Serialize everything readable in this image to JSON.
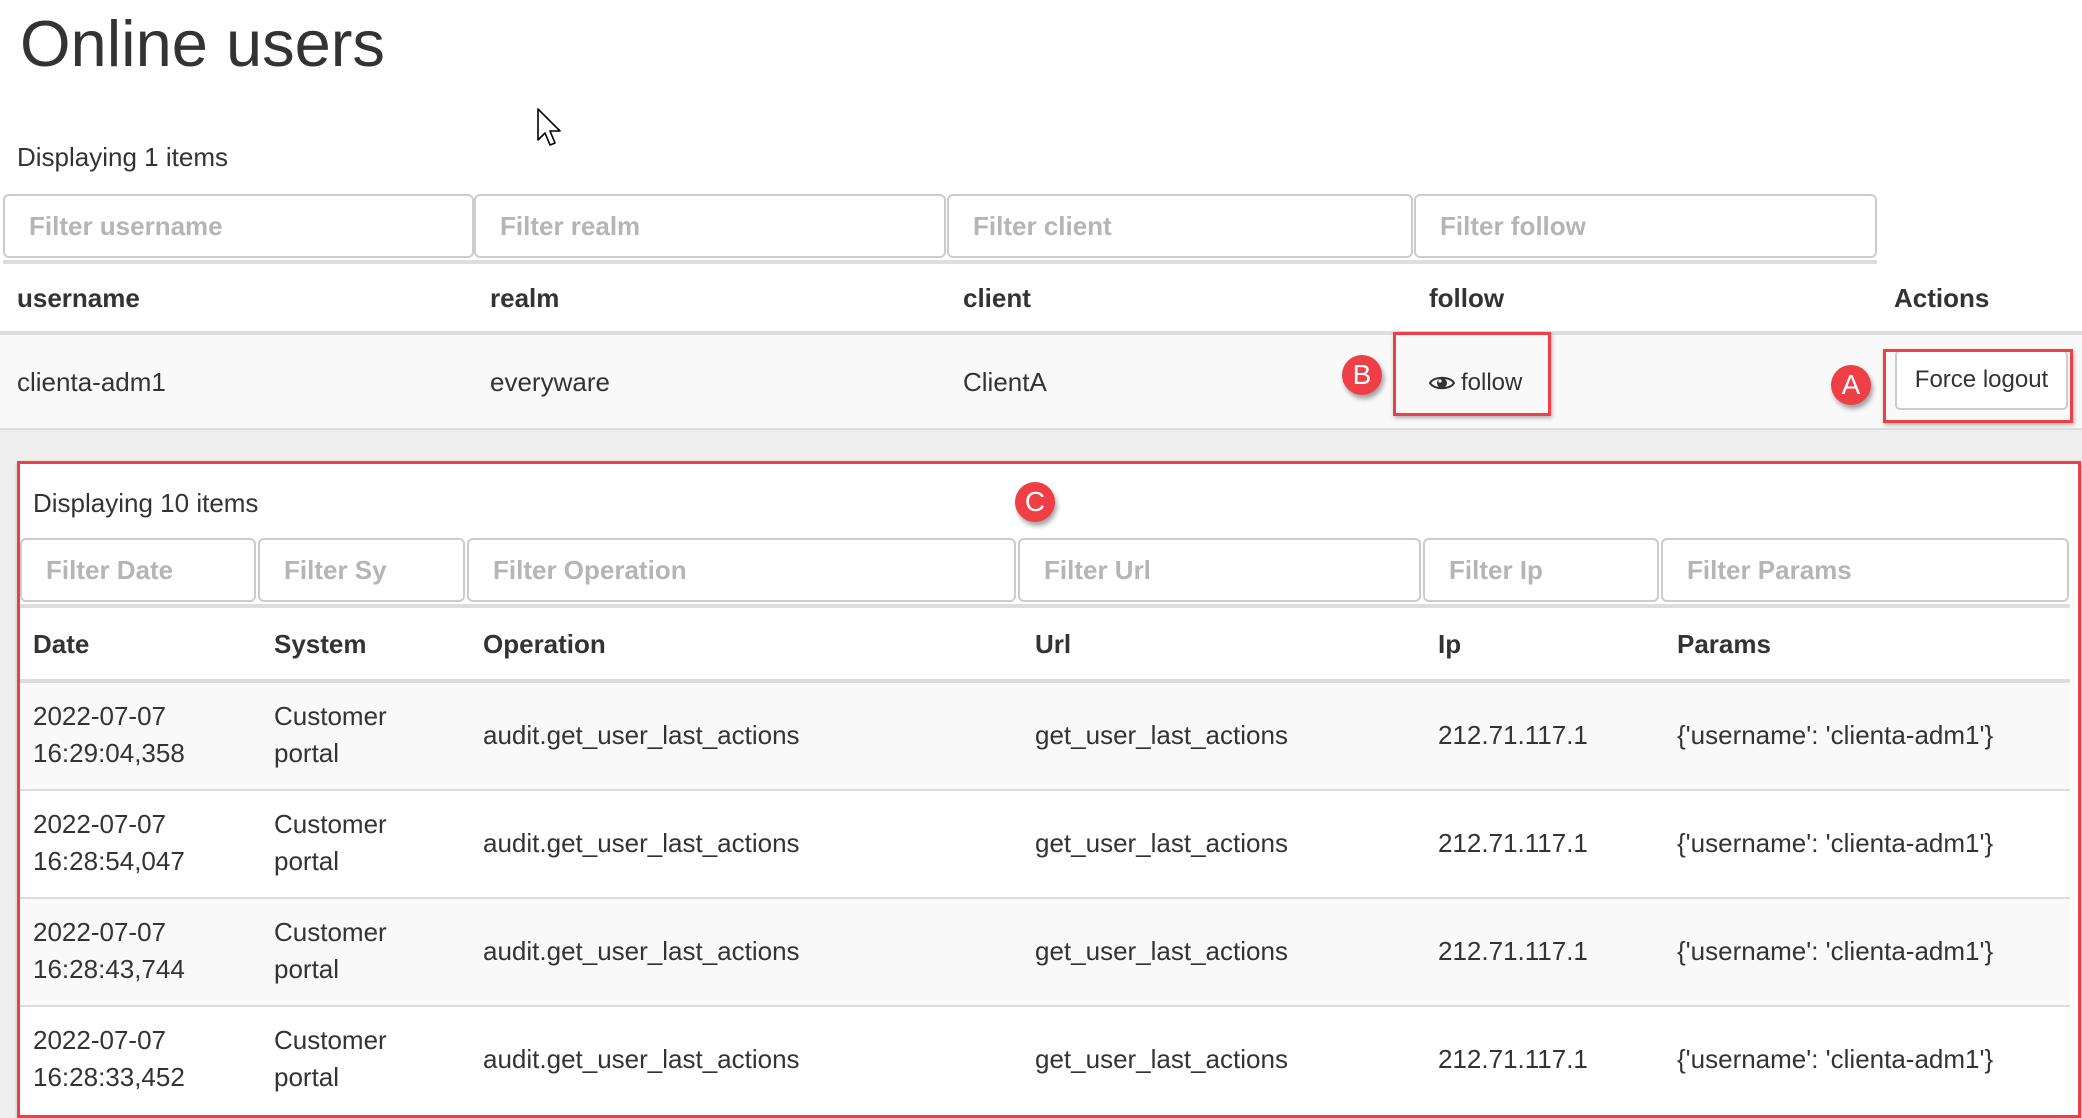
{
  "page": {
    "title": "Online users",
    "count_label": "Displaying 1 items"
  },
  "users_table": {
    "filters": [
      {
        "placeholder": "Filter username"
      },
      {
        "placeholder": "Filter realm"
      },
      {
        "placeholder": "Filter client"
      },
      {
        "placeholder": "Filter follow"
      }
    ],
    "columns": [
      "username",
      "realm",
      "client",
      "follow",
      "Actions"
    ],
    "rows": [
      {
        "username": "clienta-adm1",
        "realm": "everyware",
        "client": "ClientA",
        "follow_label": "follow",
        "follow_icon": "eye-icon",
        "action_label": "Force logout"
      }
    ]
  },
  "annotations": {
    "a": "A",
    "b": "B",
    "c": "C",
    "color": "#ef3f46"
  },
  "actions_table": {
    "count_label": "Displaying 10 items",
    "filters": [
      {
        "placeholder": "Filter Date"
      },
      {
        "placeholder": "Filter Sy"
      },
      {
        "placeholder": "Filter Operation"
      },
      {
        "placeholder": "Filter Url"
      },
      {
        "placeholder": "Filter Ip"
      },
      {
        "placeholder": "Filter Params"
      }
    ],
    "columns": [
      "Date",
      "System",
      "Operation",
      "Url",
      "Ip",
      "Params"
    ],
    "rows": [
      {
        "date_line1": "2022-07-07",
        "date_line2": "16:29:04,358",
        "system_line1": "Customer",
        "system_line2": "portal",
        "operation": "audit.get_user_last_actions",
        "url": "get_user_last_actions",
        "ip": "212.71.117.1",
        "params": "{'username': 'clienta-adm1'}"
      },
      {
        "date_line1": "2022-07-07",
        "date_line2": "16:28:54,047",
        "system_line1": "Customer",
        "system_line2": "portal",
        "operation": "audit.get_user_last_actions",
        "url": "get_user_last_actions",
        "ip": "212.71.117.1",
        "params": "{'username': 'clienta-adm1'}"
      },
      {
        "date_line1": "2022-07-07",
        "date_line2": "16:28:43,744",
        "system_line1": "Customer",
        "system_line2": "portal",
        "operation": "audit.get_user_last_actions",
        "url": "get_user_last_actions",
        "ip": "212.71.117.1",
        "params": "{'username': 'clienta-adm1'}"
      },
      {
        "date_line1": "2022-07-07",
        "date_line2": "16:28:33,452",
        "system_line1": "Customer",
        "system_line2": "portal",
        "operation": "audit.get_user_last_actions",
        "url": "get_user_last_actions",
        "ip": "212.71.117.1",
        "params": "{'username': 'clienta-adm1'}"
      }
    ]
  }
}
